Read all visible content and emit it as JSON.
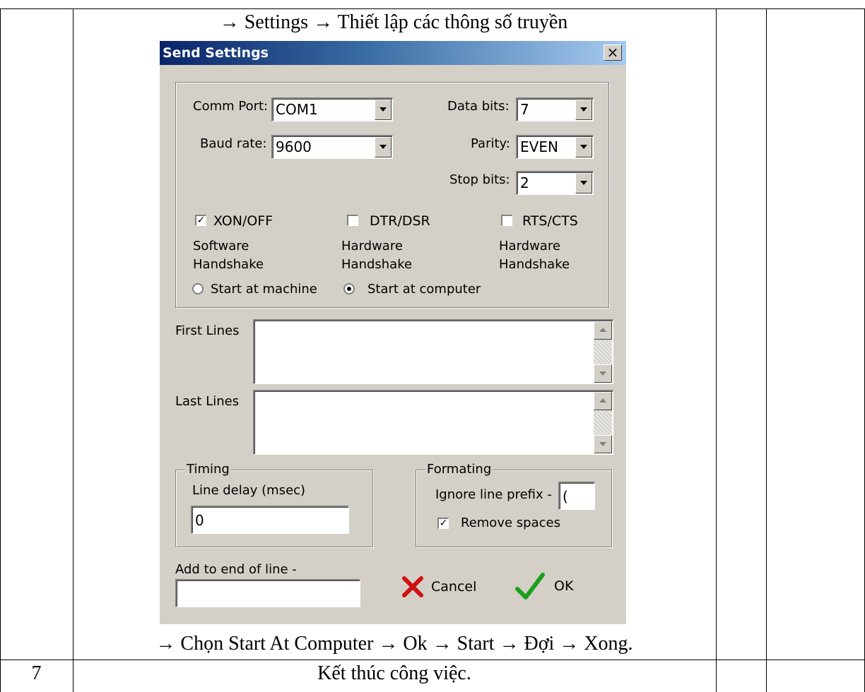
{
  "doc": {
    "top_caption": "→ Settings → Thiết lập các thông số truyền",
    "bottom_caption": "→ Chọn Start At Computer → Ok → Start → Đợi → Xong.",
    "row_number": "7",
    "row_text": "Kết thúc công việc."
  },
  "dialog": {
    "title": "Send Settings",
    "close_glyph": "×",
    "comm_port": {
      "label": "Comm Port:",
      "value": "COM1"
    },
    "baud_rate": {
      "label": "Baud rate:",
      "value": "9600"
    },
    "data_bits": {
      "label": "Data bits:",
      "value": "7"
    },
    "parity": {
      "label": "Parity:",
      "value": "EVEN"
    },
    "stop_bits": {
      "label": "Stop bits:",
      "value": "2"
    },
    "xon_off": {
      "label": "XON/OFF",
      "checked": true,
      "sub1": "Software",
      "sub2": "Handshake"
    },
    "dtr_dsr": {
      "label": "DTR/DSR",
      "checked": false,
      "sub1": "Hardware",
      "sub2": "Handshake"
    },
    "rts_cts": {
      "label": "RTS/CTS",
      "checked": false,
      "sub1": "Hardware",
      "sub2": "Handshake"
    },
    "start_machine": "Start at machine",
    "start_computer": "Start at computer",
    "first_lines": "First Lines",
    "last_lines": "Last Lines",
    "timing": {
      "legend": "Timing",
      "label": "Line delay (msec)",
      "value": "0"
    },
    "formating": {
      "legend": "Formating",
      "prefix_label": "Ignore line prefix -",
      "prefix_value": "(",
      "remove_spaces": "Remove spaces",
      "remove_checked": true
    },
    "add_end": {
      "label": "Add to end of line -",
      "value": ""
    },
    "cancel": "Cancel",
    "ok": "OK",
    "colors": {
      "title_start": "#0a246a",
      "title_end": "#a6caf0",
      "face": "#d4d0c8",
      "cancel_x": "#d01010",
      "ok_check": "#1aa01a"
    }
  }
}
